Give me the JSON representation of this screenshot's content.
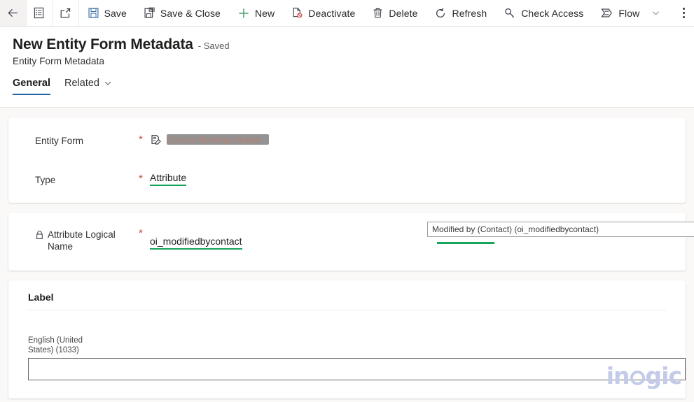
{
  "commandbar": {
    "icon_buttons": [
      {
        "name": "back-arrow-icon",
        "label": "Back"
      },
      {
        "name": "form-list-icon",
        "label": "Form"
      },
      {
        "name": "popout-icon",
        "label": "Open in new window"
      }
    ],
    "buttons": [
      {
        "name": "save-button",
        "label": "Save",
        "icon": "save-floppy-icon"
      },
      {
        "name": "save-close-button",
        "label": "Save & Close",
        "icon": "save-close-icon"
      },
      {
        "name": "new-button",
        "label": "New",
        "icon": "plus-icon"
      },
      {
        "name": "deactivate-button",
        "label": "Deactivate",
        "icon": "deactivate-icon"
      },
      {
        "name": "delete-button",
        "label": "Delete",
        "icon": "trash-icon"
      },
      {
        "name": "refresh-button",
        "label": "Refresh",
        "icon": "refresh-icon"
      },
      {
        "name": "check-access-button",
        "label": "Check Access",
        "icon": "key-icon"
      },
      {
        "name": "flow-button",
        "label": "Flow",
        "icon": "flow-icon"
      }
    ],
    "overflow_label": "More commands"
  },
  "header": {
    "title": "New Entity Form Metadata",
    "saved_state": "- Saved",
    "entity_name": "Entity Form Metadata"
  },
  "tabs": [
    {
      "label": "General",
      "active": true,
      "has_chevron": false
    },
    {
      "label": "Related",
      "active": false,
      "has_chevron": true
    }
  ],
  "form": {
    "entity_form": {
      "label": "Entity Form",
      "required": "*",
      "value_redacted": "",
      "redacted_ghost_text": "Contact Booking Update"
    },
    "type": {
      "label": "Type",
      "required": "*",
      "value": "Attribute"
    },
    "attribute_logical_name": {
      "label": "Attribute Logical Name",
      "required": "*",
      "value": "oi_modifiedbycontact",
      "locked": true
    },
    "suggestion": {
      "text": "Modified by (Contact) (oi_modifiedbycontact)"
    },
    "label_section": {
      "heading": "Label",
      "language_label": "English (United States) (1033)",
      "input_value": "",
      "input_placeholder": ""
    }
  },
  "watermark": {
    "text_before": "in",
    "text_after": "gic"
  },
  "colors": {
    "accent_blue": "#2266aa",
    "required_red": "#c94a3b",
    "underline_green": "#16a45a",
    "save_icon_blue": "#3a6ea5",
    "new_icon_green": "#4aa06a",
    "canvas_bg": "#faf9f8",
    "watermark": "#c3cbe8"
  }
}
